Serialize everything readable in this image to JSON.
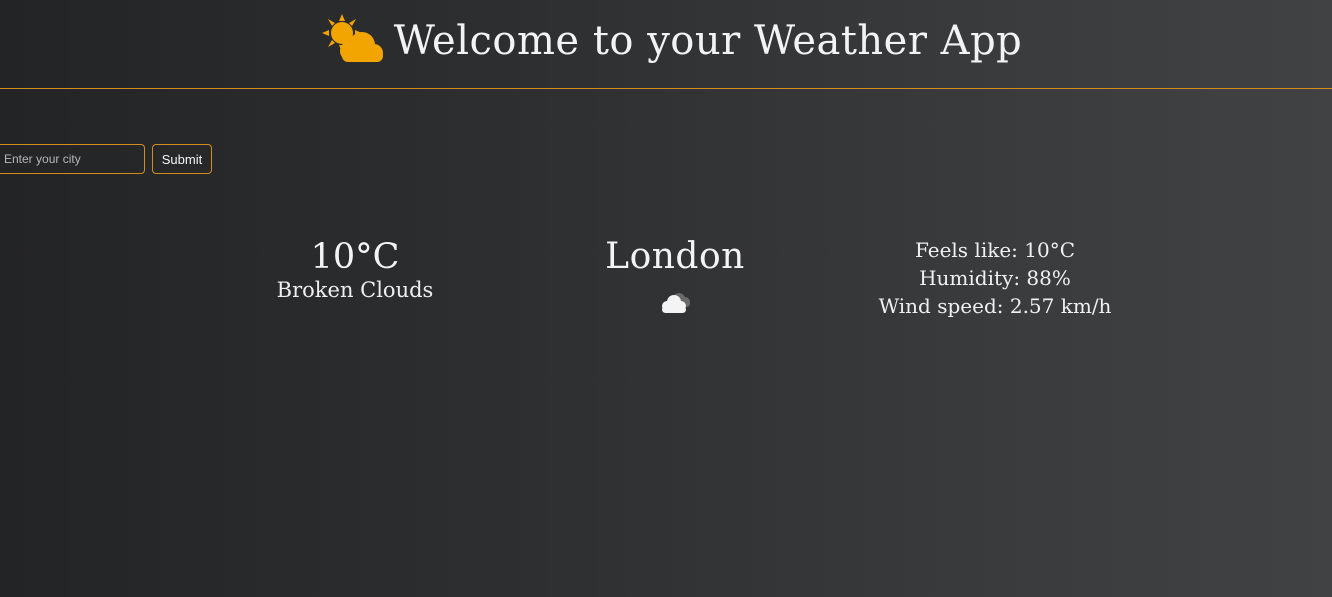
{
  "app": {
    "title": "Welcome to your Weather App",
    "icon": "sun-behind-cloud-icon",
    "accent_color": "#d08d22"
  },
  "search": {
    "placeholder": "Enter your city",
    "value": "",
    "submit_label": "Submit"
  },
  "weather": {
    "temperature": "10°C",
    "description": "Broken Clouds",
    "city": "London",
    "condition_icon": "broken-clouds-icon",
    "details": [
      "Feels like: 10°C",
      "Humidity: 88%",
      "Wind speed: 2.57 km/h"
    ]
  }
}
